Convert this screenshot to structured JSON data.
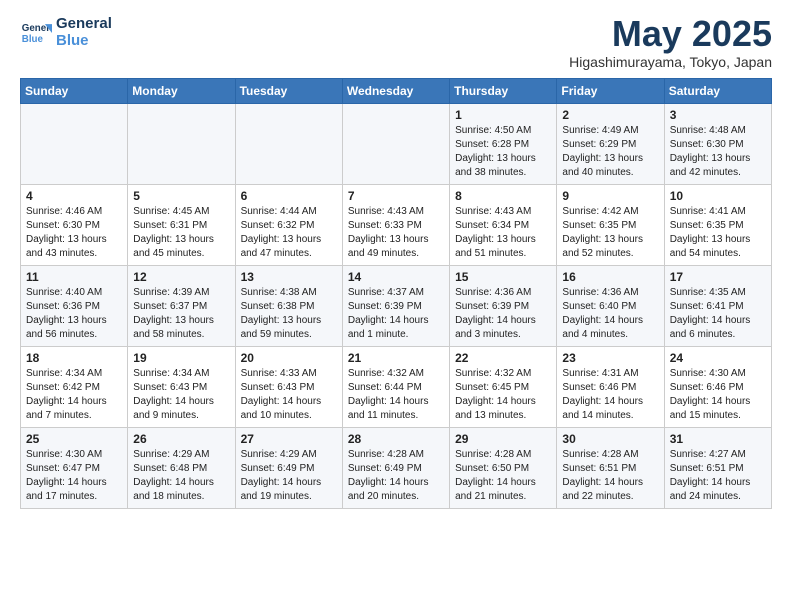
{
  "header": {
    "logo_line1": "General",
    "logo_line2": "Blue",
    "month_title": "May 2025",
    "location": "Higashimurayama, Tokyo, Japan"
  },
  "weekdays": [
    "Sunday",
    "Monday",
    "Tuesday",
    "Wednesday",
    "Thursday",
    "Friday",
    "Saturday"
  ],
  "rows": [
    [
      {
        "day": "",
        "info": ""
      },
      {
        "day": "",
        "info": ""
      },
      {
        "day": "",
        "info": ""
      },
      {
        "day": "",
        "info": ""
      },
      {
        "day": "1",
        "info": "Sunrise: 4:50 AM\nSunset: 6:28 PM\nDaylight: 13 hours\nand 38 minutes."
      },
      {
        "day": "2",
        "info": "Sunrise: 4:49 AM\nSunset: 6:29 PM\nDaylight: 13 hours\nand 40 minutes."
      },
      {
        "day": "3",
        "info": "Sunrise: 4:48 AM\nSunset: 6:30 PM\nDaylight: 13 hours\nand 42 minutes."
      }
    ],
    [
      {
        "day": "4",
        "info": "Sunrise: 4:46 AM\nSunset: 6:30 PM\nDaylight: 13 hours\nand 43 minutes."
      },
      {
        "day": "5",
        "info": "Sunrise: 4:45 AM\nSunset: 6:31 PM\nDaylight: 13 hours\nand 45 minutes."
      },
      {
        "day": "6",
        "info": "Sunrise: 4:44 AM\nSunset: 6:32 PM\nDaylight: 13 hours\nand 47 minutes."
      },
      {
        "day": "7",
        "info": "Sunrise: 4:43 AM\nSunset: 6:33 PM\nDaylight: 13 hours\nand 49 minutes."
      },
      {
        "day": "8",
        "info": "Sunrise: 4:43 AM\nSunset: 6:34 PM\nDaylight: 13 hours\nand 51 minutes."
      },
      {
        "day": "9",
        "info": "Sunrise: 4:42 AM\nSunset: 6:35 PM\nDaylight: 13 hours\nand 52 minutes."
      },
      {
        "day": "10",
        "info": "Sunrise: 4:41 AM\nSunset: 6:35 PM\nDaylight: 13 hours\nand 54 minutes."
      }
    ],
    [
      {
        "day": "11",
        "info": "Sunrise: 4:40 AM\nSunset: 6:36 PM\nDaylight: 13 hours\nand 56 minutes."
      },
      {
        "day": "12",
        "info": "Sunrise: 4:39 AM\nSunset: 6:37 PM\nDaylight: 13 hours\nand 58 minutes."
      },
      {
        "day": "13",
        "info": "Sunrise: 4:38 AM\nSunset: 6:38 PM\nDaylight: 13 hours\nand 59 minutes."
      },
      {
        "day": "14",
        "info": "Sunrise: 4:37 AM\nSunset: 6:39 PM\nDaylight: 14 hours\nand 1 minute."
      },
      {
        "day": "15",
        "info": "Sunrise: 4:36 AM\nSunset: 6:39 PM\nDaylight: 14 hours\nand 3 minutes."
      },
      {
        "day": "16",
        "info": "Sunrise: 4:36 AM\nSunset: 6:40 PM\nDaylight: 14 hours\nand 4 minutes."
      },
      {
        "day": "17",
        "info": "Sunrise: 4:35 AM\nSunset: 6:41 PM\nDaylight: 14 hours\nand 6 minutes."
      }
    ],
    [
      {
        "day": "18",
        "info": "Sunrise: 4:34 AM\nSunset: 6:42 PM\nDaylight: 14 hours\nand 7 minutes."
      },
      {
        "day": "19",
        "info": "Sunrise: 4:34 AM\nSunset: 6:43 PM\nDaylight: 14 hours\nand 9 minutes."
      },
      {
        "day": "20",
        "info": "Sunrise: 4:33 AM\nSunset: 6:43 PM\nDaylight: 14 hours\nand 10 minutes."
      },
      {
        "day": "21",
        "info": "Sunrise: 4:32 AM\nSunset: 6:44 PM\nDaylight: 14 hours\nand 11 minutes."
      },
      {
        "day": "22",
        "info": "Sunrise: 4:32 AM\nSunset: 6:45 PM\nDaylight: 14 hours\nand 13 minutes."
      },
      {
        "day": "23",
        "info": "Sunrise: 4:31 AM\nSunset: 6:46 PM\nDaylight: 14 hours\nand 14 minutes."
      },
      {
        "day": "24",
        "info": "Sunrise: 4:30 AM\nSunset: 6:46 PM\nDaylight: 14 hours\nand 15 minutes."
      }
    ],
    [
      {
        "day": "25",
        "info": "Sunrise: 4:30 AM\nSunset: 6:47 PM\nDaylight: 14 hours\nand 17 minutes."
      },
      {
        "day": "26",
        "info": "Sunrise: 4:29 AM\nSunset: 6:48 PM\nDaylight: 14 hours\nand 18 minutes."
      },
      {
        "day": "27",
        "info": "Sunrise: 4:29 AM\nSunset: 6:49 PM\nDaylight: 14 hours\nand 19 minutes."
      },
      {
        "day": "28",
        "info": "Sunrise: 4:28 AM\nSunset: 6:49 PM\nDaylight: 14 hours\nand 20 minutes."
      },
      {
        "day": "29",
        "info": "Sunrise: 4:28 AM\nSunset: 6:50 PM\nDaylight: 14 hours\nand 21 minutes."
      },
      {
        "day": "30",
        "info": "Sunrise: 4:28 AM\nSunset: 6:51 PM\nDaylight: 14 hours\nand 22 minutes."
      },
      {
        "day": "31",
        "info": "Sunrise: 4:27 AM\nSunset: 6:51 PM\nDaylight: 14 hours\nand 24 minutes."
      }
    ]
  ]
}
